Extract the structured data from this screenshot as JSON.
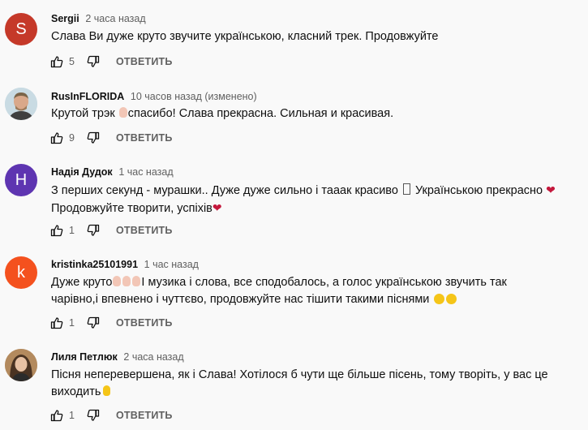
{
  "reply_label": "ОТВЕТИТЬ",
  "comments": [
    {
      "author": "Sergii",
      "time": "2 часа назад",
      "avatar_letter": "S",
      "avatar_color": "#c53929",
      "text": "Слава Ви дуже круто звучите українською, класний трек. Продовжуйте",
      "likes": "5"
    },
    {
      "author": "RusInFLORIDA",
      "time": "10 часов назад (изменено)",
      "text_a": "Крутой трэк",
      "text_b": "спасибо! Слава прекрасна. Сильная и красивая.",
      "likes": "9"
    },
    {
      "author": "Надія Дудок",
      "time": "1 час назад",
      "avatar_letter": "H",
      "avatar_color": "#5e35b1",
      "text_line1_a": "З перших секунд - мурашки.. Дуже дуже сильно і тааак красиво",
      "text_line1_b": "Українською прекрасно",
      "text_line2": "Продовжуйте творити, успіхів",
      "likes": "1"
    },
    {
      "author": "kristinka25101991",
      "time": "1 час назад",
      "avatar_letter": "k",
      "avatar_color": "#f4511e",
      "text_line1_a": "Дуже круто",
      "text_line1_b": "І музика і слова, все сподобалось, а голос українською звучить так",
      "text_line2": "чарівно,і впевнено і чуттєво, продовжуйте нас тішити такими піснями",
      "likes": "1"
    },
    {
      "author": "Лиля Петлюк",
      "time": "2 часа назад",
      "text_line1": "Пісня неперевершена, як і Слава! Хотілося б чути ще більше пісень, тому творіть, у вас це",
      "text_line2": "виходить",
      "likes": "1"
    }
  ]
}
